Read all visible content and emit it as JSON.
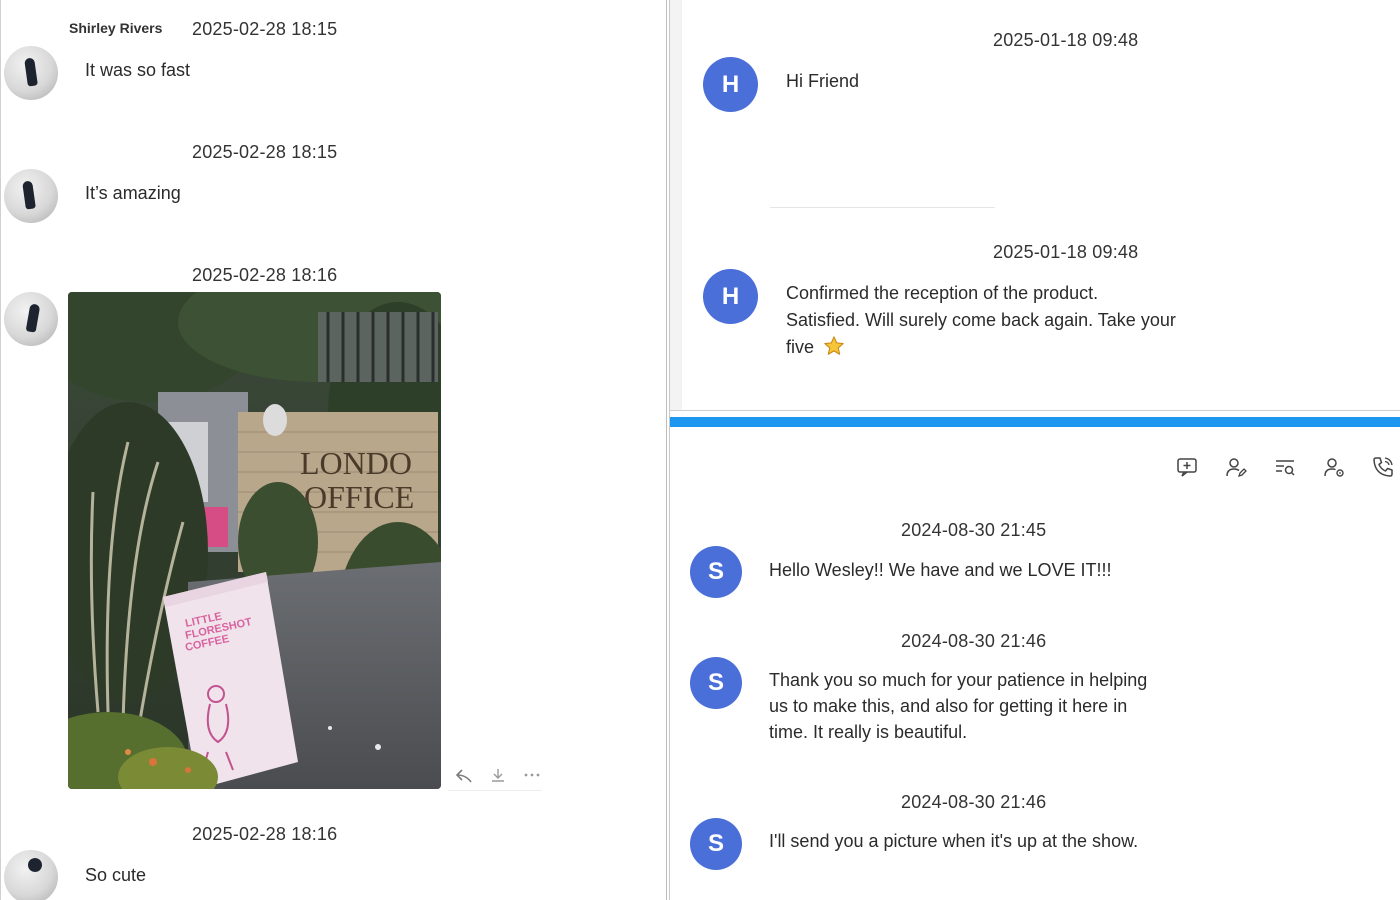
{
  "left_chat": {
    "messages": [
      {
        "sender": "Shirley Rivers",
        "timestamp": "2025-02-28 18:15",
        "text": "It was so fast"
      },
      {
        "sender": "",
        "timestamp": "2025-02-28 18:15",
        "text": "It’s amazing"
      },
      {
        "sender": "",
        "timestamp": "2025-02-28 18:16",
        "image": "photo-coffee-shop-sign"
      },
      {
        "sender": "",
        "timestamp": "2025-02-28 18:16",
        "text": "So cute"
      }
    ],
    "photo": {
      "sign_line1": "LITTLE",
      "sign_line2": "FLORESHOT",
      "sign_line3": "COFFEE",
      "wall_line1": "LONDO",
      "wall_line2": "OFFICE"
    },
    "photo_actions": [
      "reply-icon",
      "download-icon",
      "more-icon"
    ]
  },
  "right_top_chat": {
    "messages": [
      {
        "avatar_letter": "H",
        "timestamp": "2025-01-18 09:48",
        "text": "Hi Friend"
      },
      {
        "avatar_letter": "H",
        "timestamp": "2025-01-18 09:48",
        "lines": [
          "Confirmed the reception of the product.",
          "Satisfied. Will surely come back again. Take your",
          "five"
        ],
        "emoji": "star-icon"
      }
    ]
  },
  "right_bottom_chat": {
    "toolbar": [
      "add-message-icon",
      "user-edit-icon",
      "search-list-icon",
      "user-settings-icon",
      "phone-icon"
    ],
    "messages": [
      {
        "avatar_letter": "S",
        "timestamp": "2024-08-30 21:45",
        "text": "Hello Wesley!! We have and we LOVE IT!!!"
      },
      {
        "avatar_letter": "S",
        "timestamp": "2024-08-30 21:46",
        "lines": [
          "Thank you so much for your patience in helping",
          "us to make this, and also for getting it here in",
          "time. It really is beautiful."
        ]
      },
      {
        "avatar_letter": "S",
        "timestamp": "2024-08-30 21:46",
        "text": "I'll send you a picture when it's up at the show."
      }
    ]
  },
  "colors": {
    "avatar_blue": "#4a6fd8",
    "accent_bar": "#1e97f0",
    "text": "#2b2b2b"
  }
}
